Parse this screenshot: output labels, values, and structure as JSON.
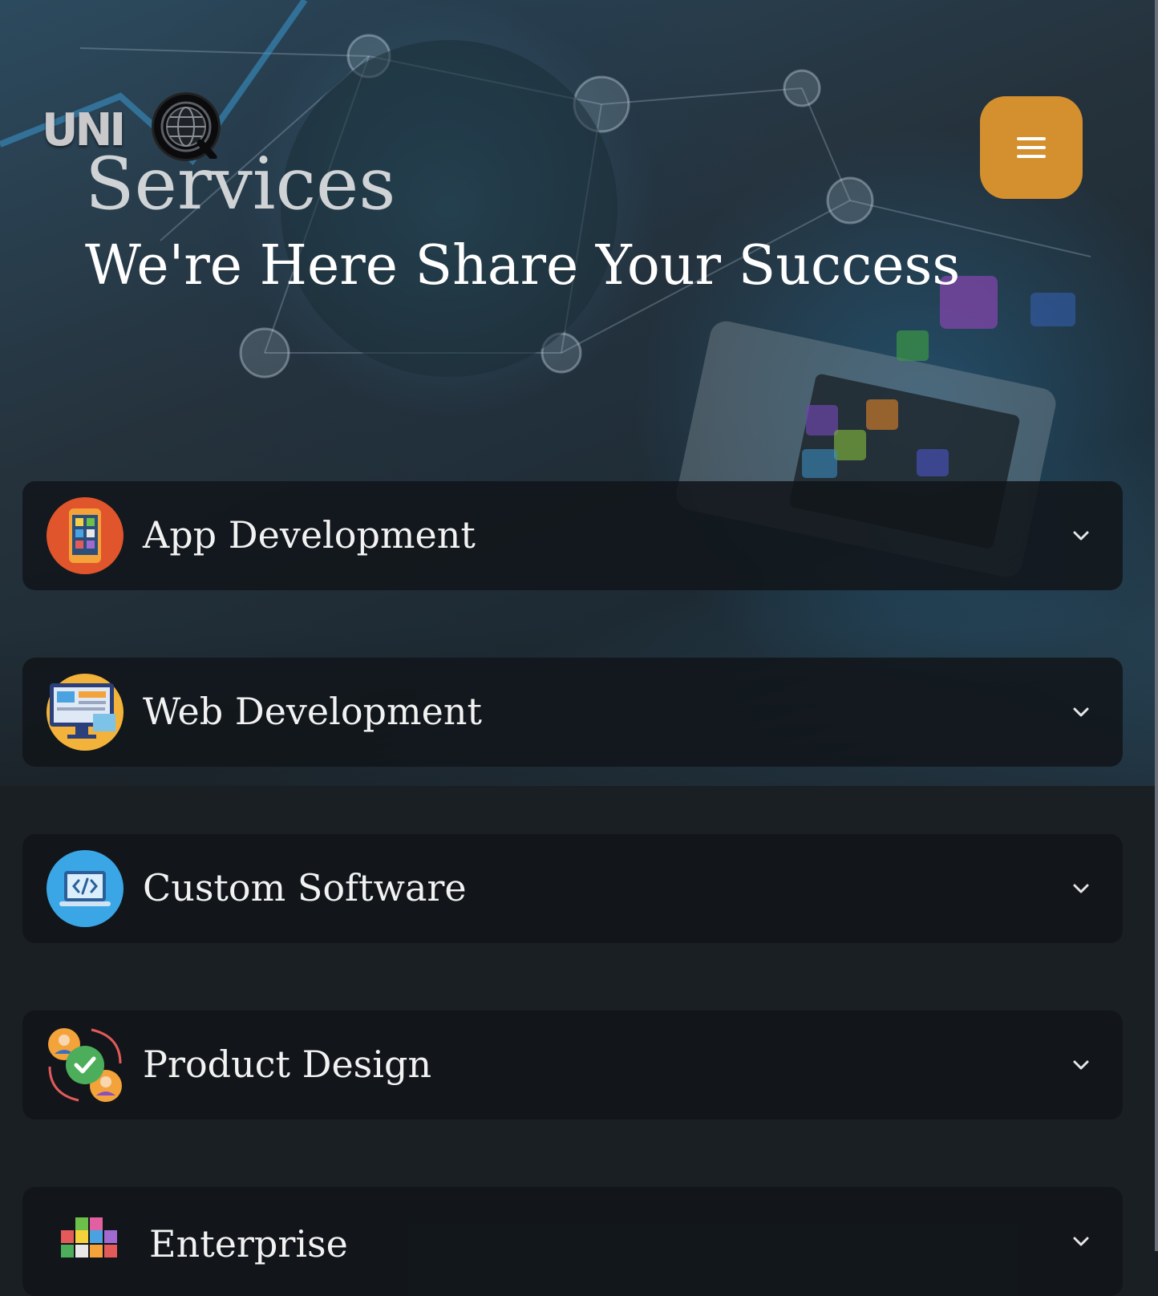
{
  "brand": {
    "logo_text": "UNI",
    "logo_icon": "globe-q-icon"
  },
  "hero": {
    "title": "Services",
    "subtitle": "We're Here Share Your Success"
  },
  "menu": {
    "icon": "hamburger-menu-icon",
    "color": "#d48f2f"
  },
  "services": [
    {
      "label": "App Development",
      "icon": "mobile-app-icon"
    },
    {
      "label": "Web Development",
      "icon": "web-monitor-icon"
    },
    {
      "label": "Custom Software",
      "icon": "code-laptop-icon"
    },
    {
      "label": "Product Design",
      "icon": "team-cycle-icon"
    },
    {
      "label": "Enterprise",
      "icon": "cube-blocks-icon"
    }
  ],
  "colors": {
    "accent": "#d48f2f",
    "card_bg": "#11161a",
    "page_bg": "#1a1f24"
  }
}
